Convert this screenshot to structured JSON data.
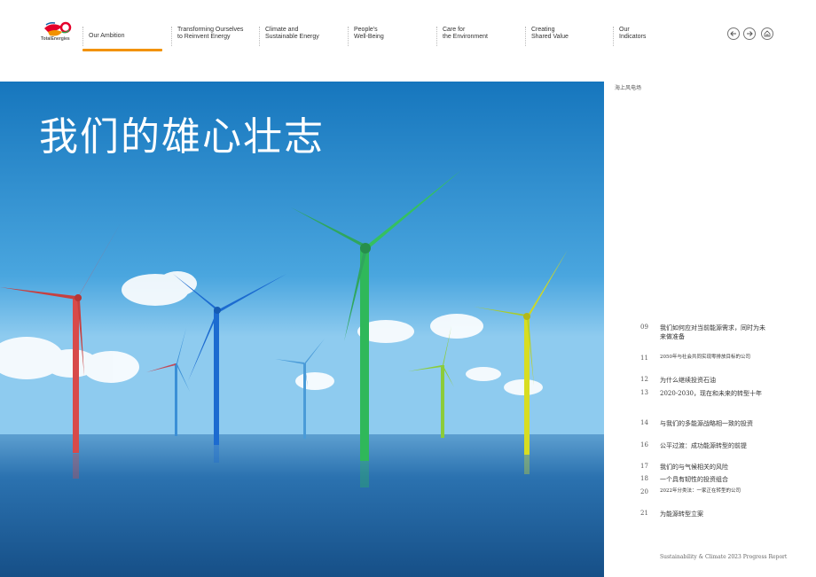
{
  "brand": {
    "logo_text": "TotalEnergies"
  },
  "nav": {
    "items": [
      {
        "line1": "Our Ambition",
        "line2": ""
      },
      {
        "line1": "Transforming Ourselves",
        "line2": "to Reinvent Energy"
      },
      {
        "line1": "Climate and",
        "line2": "Sustainable Energy"
      },
      {
        "line1": "People's",
        "line2": "Well-Being"
      },
      {
        "line1": "Care for",
        "line2": "the Environment"
      },
      {
        "line1": "Creating",
        "line2": "Shared Value"
      },
      {
        "line1": "Our",
        "line2": "Indicators"
      }
    ],
    "accent": "#f29200"
  },
  "hero": {
    "title": "我们的雄心壮志"
  },
  "side": {
    "section_label": "海上风电场"
  },
  "toc": [
    {
      "num": "09",
      "text": "我们如何应对当前能源需求，同时为未来做准备",
      "small": false
    },
    {
      "num": "11",
      "text": "2050年与社会共同实现零排放目标的公司",
      "small": true
    },
    {
      "num": "12",
      "text": "为什么继续投资石油",
      "small": false
    },
    {
      "num": "13",
      "text": "2020-2030，现在和未来的转型十年",
      "small": false
    },
    {
      "num": "14",
      "text": "与我们的多能源战略相一致的投资",
      "small": false
    },
    {
      "num": "16",
      "text": "公平过渡：成功能源转型的前提",
      "small": false
    },
    {
      "num": "17",
      "text": "我们的与气候相关的风险",
      "small": false
    },
    {
      "num": "18",
      "text": "一个具有韧性的投资组合",
      "small": false
    },
    {
      "num": "20",
      "text": "2022年分类法：一家正在转型的公司",
      "small": true
    },
    {
      "num": "21",
      "text": "为能源转型立案",
      "small": false
    }
  ],
  "footer": {
    "text": "Sustainability & Climate 2023 Progress Report"
  },
  "colors": {
    "sky_top": "#1d7fc4",
    "sea": "#1c5f99",
    "accent": "#f29200"
  }
}
